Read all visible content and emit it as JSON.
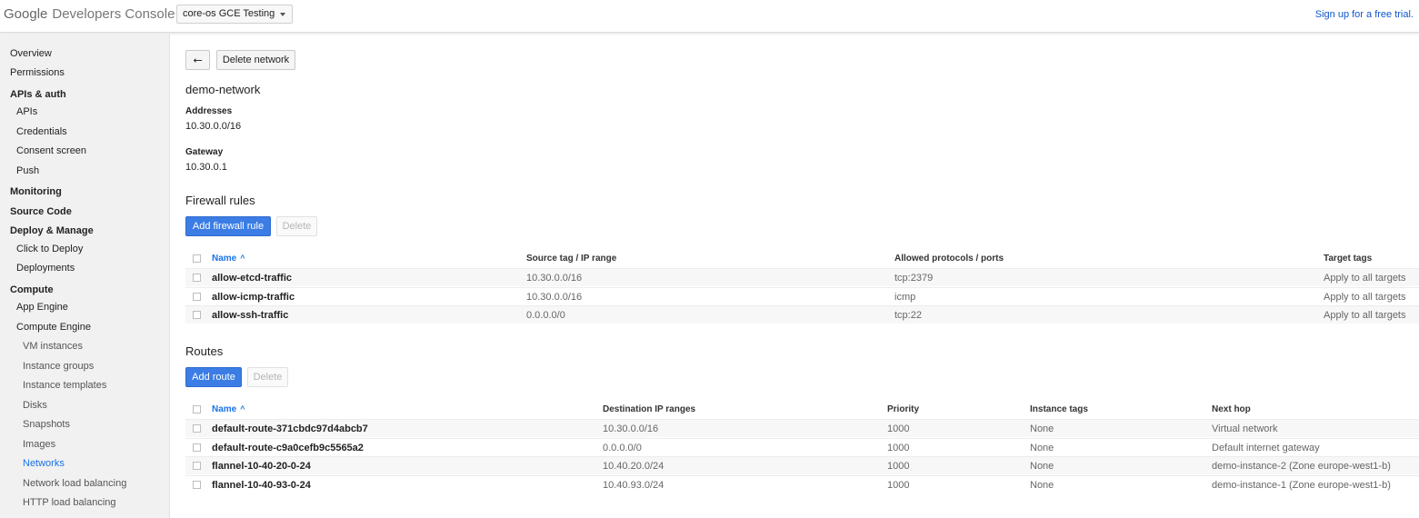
{
  "header": {
    "logo_brand": "Google",
    "logo_product": "Developers Console",
    "project": "core-os GCE Testing",
    "signup": "Sign up for a free trial."
  },
  "sidebar": {
    "items": [
      {
        "label": "Overview"
      },
      {
        "label": "Permissions"
      },
      {
        "label": "APIs & auth"
      },
      {
        "label": "APIs"
      },
      {
        "label": "Credentials"
      },
      {
        "label": "Consent screen"
      },
      {
        "label": "Push"
      },
      {
        "label": "Monitoring"
      },
      {
        "label": "Source Code"
      },
      {
        "label": "Deploy & Manage"
      },
      {
        "label": "Click to Deploy"
      },
      {
        "label": "Deployments"
      },
      {
        "label": "Compute"
      },
      {
        "label": "App Engine"
      },
      {
        "label": "Compute Engine"
      },
      {
        "label": "VM instances"
      },
      {
        "label": "Instance groups"
      },
      {
        "label": "Instance templates"
      },
      {
        "label": "Disks"
      },
      {
        "label": "Snapshots"
      },
      {
        "label": "Images"
      },
      {
        "label": "Networks"
      },
      {
        "label": "Network load balancing"
      },
      {
        "label": "HTTP load balancing"
      }
    ]
  },
  "toolbar": {
    "back_icon": "back-arrow-icon",
    "back_glyph": "⭠",
    "delete_network": "Delete network"
  },
  "network": {
    "name": "demo-network",
    "addresses_label": "Addresses",
    "addresses": "10.30.0.0/16",
    "gateway_label": "Gateway",
    "gateway": "10.30.0.1"
  },
  "firewall": {
    "title": "Firewall rules",
    "add_button": "Add firewall rule",
    "delete_button": "Delete",
    "columns": [
      "Name",
      "Source tag / IP range",
      "Allowed protocols / ports",
      "Target tags"
    ],
    "sort_glyph": "^",
    "rows": [
      [
        "allow-etcd-traffic",
        "10.30.0.0/16",
        "tcp:2379",
        "Apply to all targets"
      ],
      [
        "allow-icmp-traffic",
        "10.30.0.0/16",
        "icmp",
        "Apply to all targets"
      ],
      [
        "allow-ssh-traffic",
        "0.0.0.0/0",
        "tcp:22",
        "Apply to all targets"
      ]
    ]
  },
  "routes": {
    "title": "Routes",
    "add_button": "Add route",
    "delete_button": "Delete",
    "columns": [
      "Name",
      "Destination IP ranges",
      "Priority",
      "Instance tags",
      "Next hop"
    ],
    "sort_glyph": "^",
    "rows": [
      [
        "default-route-371cbdc97d4abcb7",
        "10.30.0.0/16",
        "1000",
        "None",
        "Virtual network"
      ],
      [
        "default-route-c9a0cefb9c5565a2",
        "0.0.0.0/0",
        "1000",
        "None",
        "Default internet gateway"
      ],
      [
        "flannel-10-40-20-0-24",
        "10.40.20.0/24",
        "1000",
        "None",
        "demo-instance-2 (Zone europe-west1-b)"
      ],
      [
        "flannel-10-40-93-0-24",
        "10.40.93.0/24",
        "1000",
        "None",
        "demo-instance-1 (Zone europe-west1-b)"
      ]
    ]
  },
  "colors": {
    "accent": "#3b7de4",
    "link": "#1a73e8",
    "sidebar_bg": "#f1f1f1"
  }
}
